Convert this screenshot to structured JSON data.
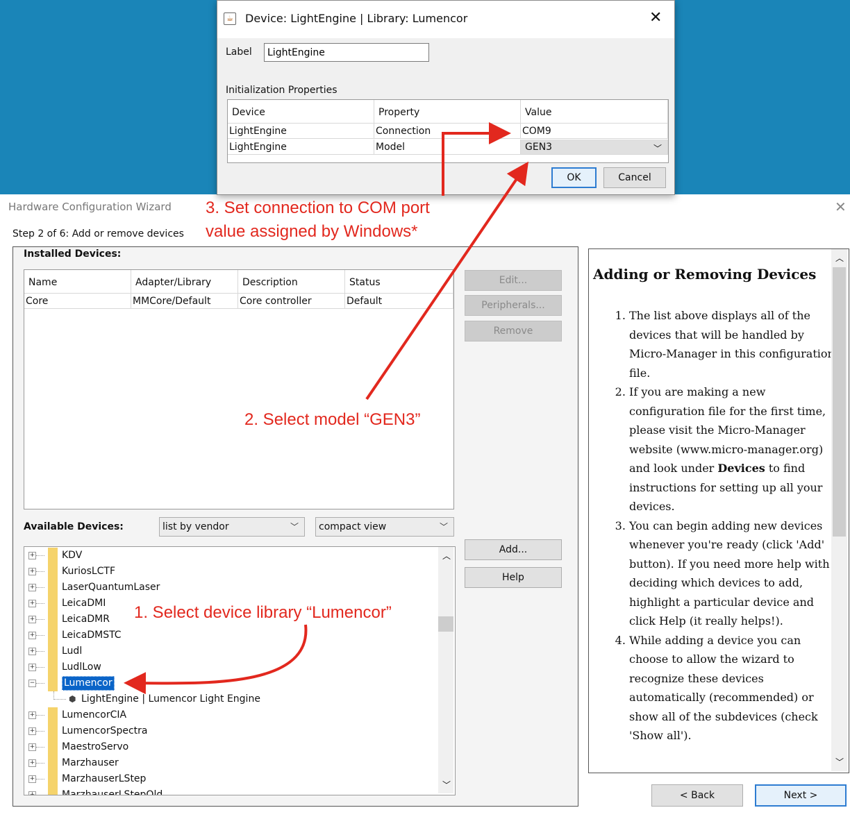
{
  "dialog": {
    "title": "Device: LightEngine | Library: Lumencor",
    "label_caption": "Label",
    "label_value": "LightEngine",
    "init_props_caption": "Initialization Properties",
    "columns": [
      "Device",
      "Property",
      "Value"
    ],
    "rows": [
      {
        "device": "LightEngine",
        "property": "Connection",
        "value": "COM9"
      },
      {
        "device": "LightEngine",
        "property": "Model",
        "value": "GEN3"
      }
    ],
    "ok_label": "OK",
    "cancel_label": "Cancel"
  },
  "wizard": {
    "title": "Hardware Configuration Wizard",
    "step": "Step 2 of 6: Add or remove devices",
    "installed_label": "Installed Devices:",
    "installed_columns": [
      "Name",
      "Adapter/Library",
      "Description",
      "Status"
    ],
    "installed_rows": [
      {
        "name": "Core",
        "adapter": "MMCore/Default",
        "description": "Core controller",
        "status": "Default"
      }
    ],
    "buttons": {
      "edit": "Edit...",
      "peripherals": "Peripherals...",
      "remove": "Remove",
      "add": "Add...",
      "help": "Help",
      "back": "< Back",
      "next": "Next >"
    },
    "available_label": "Available Devices:",
    "list_mode": "list by vendor",
    "view_mode": "compact view",
    "tree_items": [
      "KDV",
      "KuriosLCTF",
      "LaserQuantumLaser",
      "LeicaDMI",
      "LeicaDMR",
      "LeicaDMSTC",
      "Ludl",
      "LudlLow",
      "Lumencor",
      "LightEngine | Lumencor Light Engine",
      "LumencorCIA",
      "LumencorSpectra",
      "MaestroServo",
      "Marzhauser",
      "MarzhauserLStep",
      "MarzhauserLStepOld"
    ],
    "selected_item": "Lumencor"
  },
  "help": {
    "title": "Adding or Removing Devices",
    "items": [
      "The list above displays all of the devices that will be handled by Micro-Manager in this configuration file.",
      "If you are making a new configuration file for the first time, please visit the Micro-Manager website (www.micro-manager.org) and look under ",
      "You can begin adding new devices whenever you're ready (click 'Add' button). If you need more help with deciding which devices to add, highlight a particular device and click Help (it really helps!).",
      "While adding a device you can choose to allow the wizard to recognize these devices automatically (recommended) or show all of the subdevices (check 'Show all')."
    ],
    "bold_word": "Devices",
    "item2_tail": " to find instructions for setting up all your devices."
  },
  "annotations": {
    "step1": "1. Select device library “Lumencor”",
    "step2": "2. Select model “GEN3”",
    "step3_line1": "3. Set connection to COM port",
    "step3_line2": "value assigned by Windows*"
  },
  "colors": {
    "annotation": "#e2281e",
    "background_band": "#1a85b8",
    "selection": "#0a64c8",
    "folder": "#f5d36b"
  }
}
